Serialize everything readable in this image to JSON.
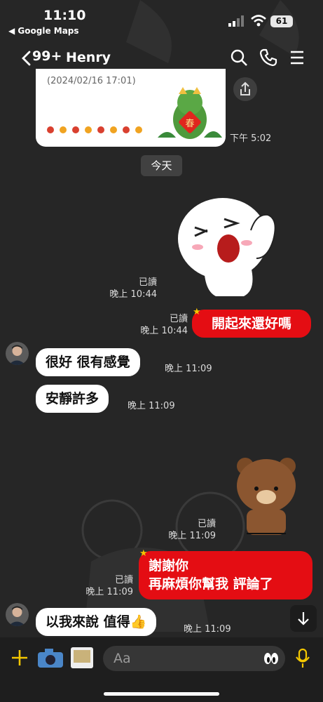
{
  "status_bar": {
    "time": "11:10",
    "back_app": "◀ Google Maps",
    "battery": "61"
  },
  "header": {
    "unread_count": "99+",
    "contact_name": "Henry"
  },
  "card": {
    "date_text": "(2024/02/16 17:01)",
    "stamp_char": "春"
  },
  "messages": {
    "card_time": "下午 5:02",
    "date_divider": "今天",
    "sticker1_read": "已讀",
    "sticker1_time": "晚上 10:44",
    "out1_read": "已讀",
    "out1_time": "晚上 10:44",
    "out1_text": "開起來還好嗎",
    "in1_text": "很好 很有感覺",
    "in1_time": "晚上 11:09",
    "in2_text": "安靜許多",
    "in2_time": "晚上 11:09",
    "sticker2_read": "已讀",
    "sticker2_time": "晚上 11:09",
    "out2_read": "已讀",
    "out2_time": "晚上 11:09",
    "out2_line1": "謝謝你",
    "out2_line2": "再麻煩你幫我 評論了",
    "in3_text": "以我來說 值得👍",
    "in3_time": "晚上 11:09"
  },
  "input": {
    "placeholder": "Aa"
  },
  "icons": {
    "back": "chevron-left-icon",
    "search": "search-icon",
    "call": "phone-icon",
    "menu": "menu-icon",
    "share": "share-icon",
    "add": "plus-icon",
    "camera": "camera-icon",
    "album": "photo-icon",
    "emoji": "sticker-icon",
    "mic": "mic-icon",
    "scroll": "chevron-down-icon"
  },
  "colors": {
    "accent_red": "#e40d13",
    "background": "#262626",
    "mic": "#f3c700"
  }
}
